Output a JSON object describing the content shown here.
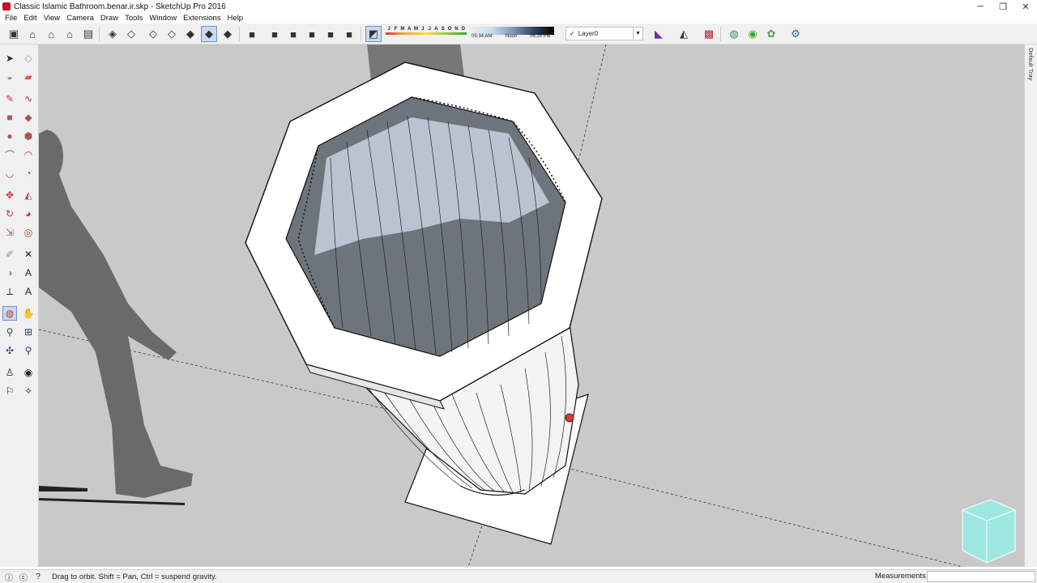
{
  "window": {
    "title": "Classic Islamic Bathroom.benar.ir.skp - SketchUp Pro 2016",
    "minimize": "─",
    "maximize": "❐",
    "close": "✕"
  },
  "menu": [
    "File",
    "Edit",
    "View",
    "Camera",
    "Draw",
    "Tools",
    "Window",
    "Extensions",
    "Help"
  ],
  "shadow": {
    "months": [
      "J",
      "F",
      "M",
      "A",
      "M",
      "J",
      "J",
      "A",
      "S",
      "O",
      "N",
      "D"
    ],
    "time_start": "05:34 AM",
    "time_mid": "Noon",
    "time_end": "06:25 PM"
  },
  "layer": {
    "check": "✓",
    "name": "Layer0",
    "dropdown": "▼"
  },
  "tray": {
    "label": "Default Tray"
  },
  "status": {
    "hint": "Drag to orbit. Shift = Pan, Ctrl = suspend gravity.",
    "measurements_label": "Measurements",
    "measurements_value": ""
  },
  "colors": {
    "accent": "#6f94c4",
    "viewport_bg": "#c9c9c9",
    "shadow": "#6a6a6a"
  }
}
